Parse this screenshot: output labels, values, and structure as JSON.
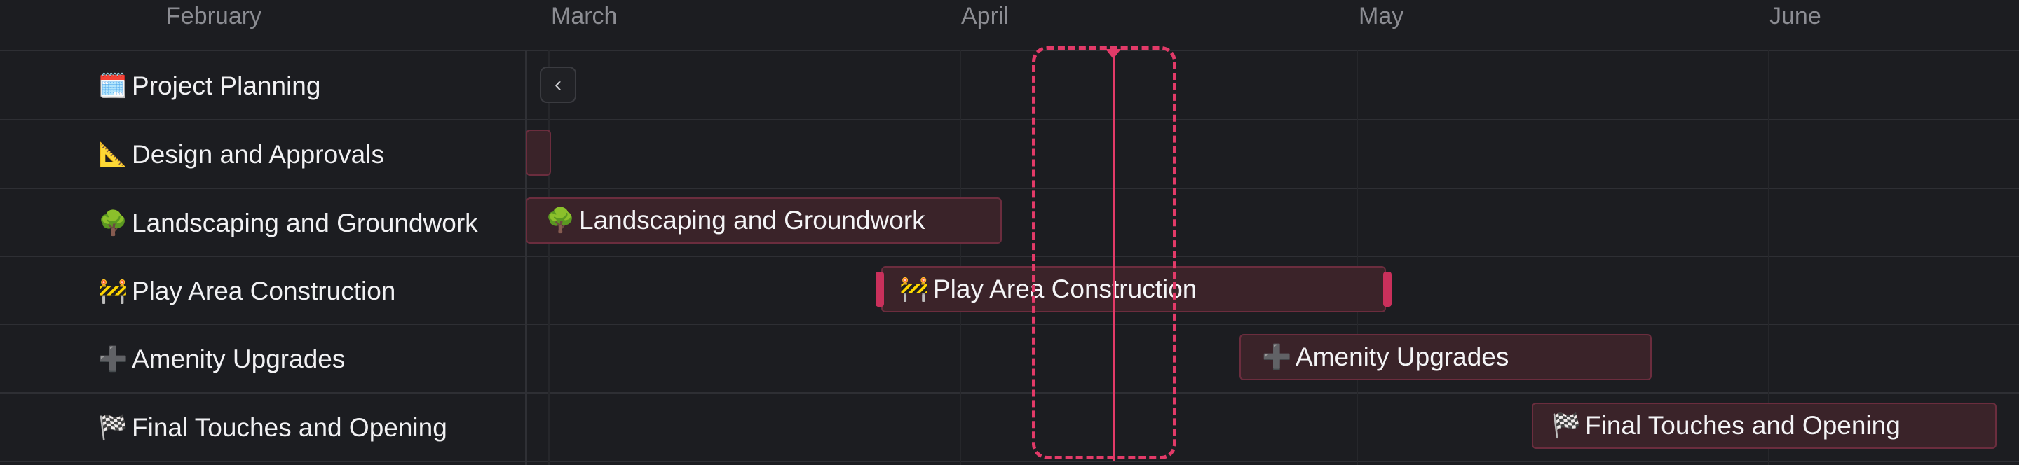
{
  "timeline": {
    "months": [
      "February",
      "March",
      "April",
      "May",
      "June"
    ]
  },
  "tasks": [
    {
      "icon": "🗓️",
      "icon_name": "calendar-icon",
      "label": "Project Planning"
    },
    {
      "icon": "📐",
      "icon_name": "triangle-ruler-icon",
      "label": "Design and Approvals"
    },
    {
      "icon": "🌳",
      "icon_name": "tree-icon",
      "label": "Landscaping and Groundwork"
    },
    {
      "icon": "🚧",
      "icon_name": "construction-barrier-icon",
      "label": "Play Area Construction"
    },
    {
      "icon": "➕",
      "icon_name": "plus-icon",
      "label": "Amenity Upgrades"
    },
    {
      "icon": "🏁",
      "icon_name": "checkered-flag-icon",
      "label": "Final Touches and Opening"
    }
  ],
  "controls": {
    "back_icon": "‹"
  },
  "colors": {
    "background": "#1c1d21",
    "bar_fill": "#3a2329",
    "bar_border": "#6b2d3e",
    "today_marker": "#e23a68"
  }
}
